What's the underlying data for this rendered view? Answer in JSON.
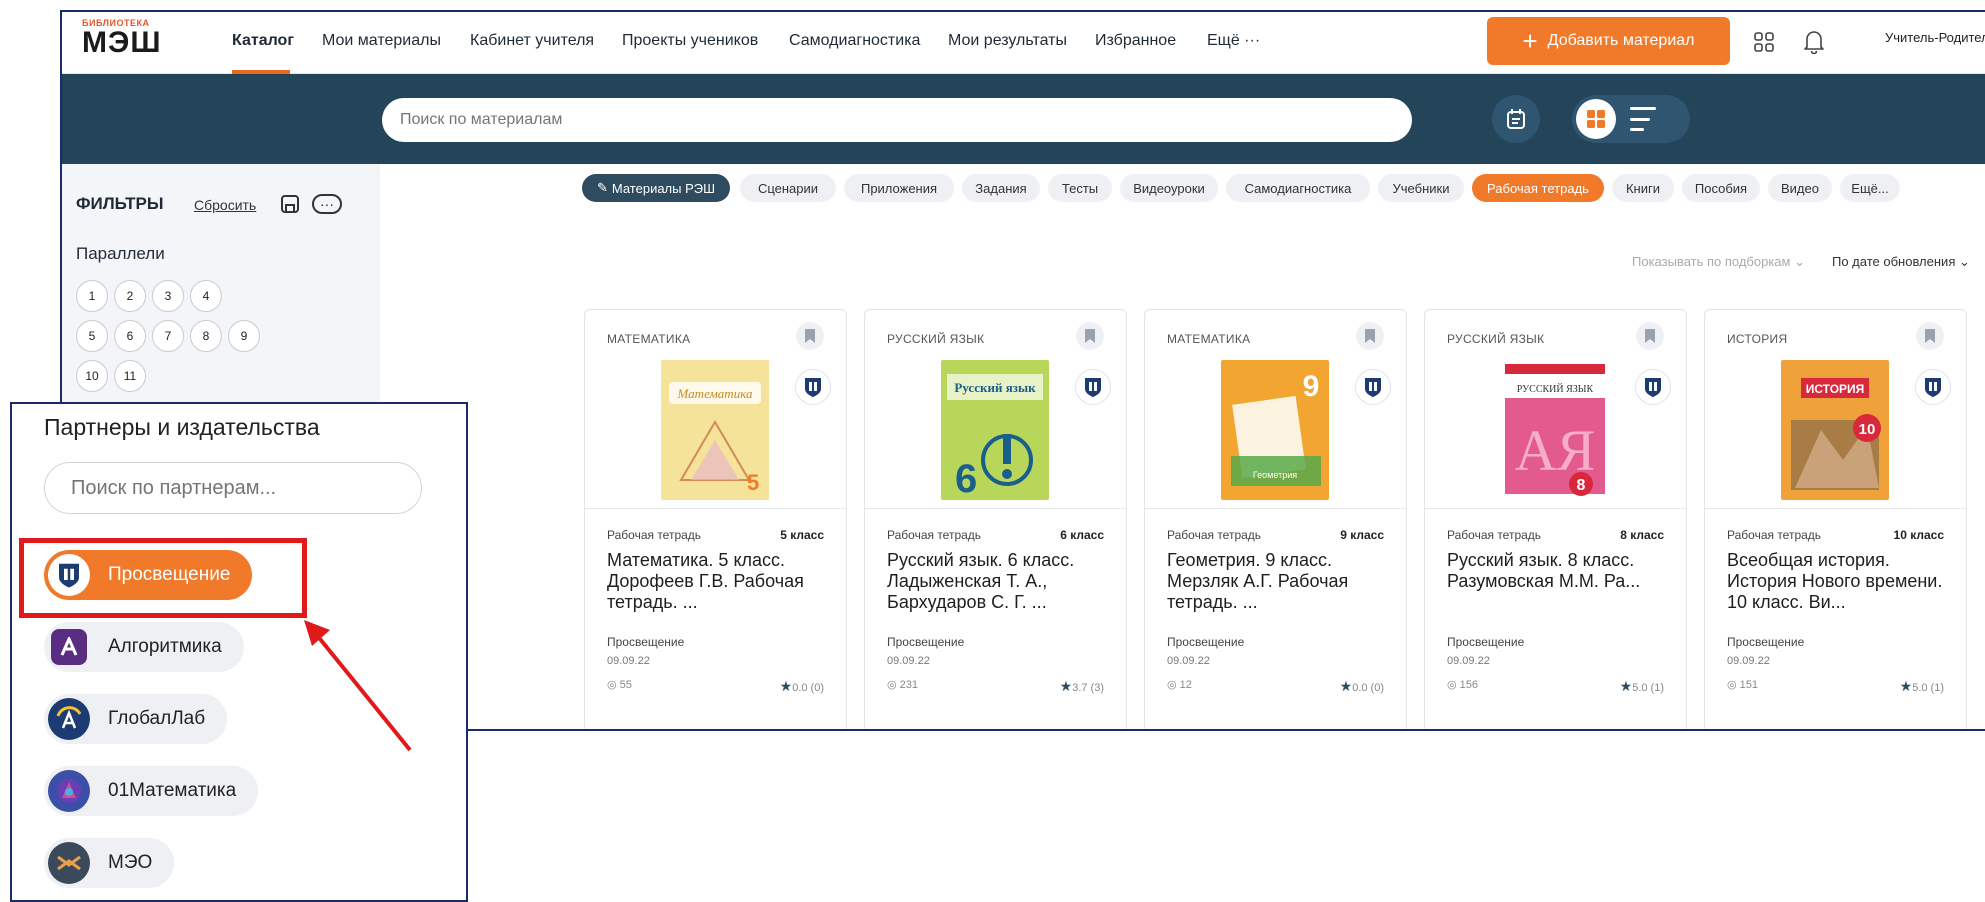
{
  "logo": {
    "small": "БИБЛИОТЕКА",
    "big": "МЭШ"
  },
  "nav": {
    "items": [
      "Каталог",
      "Мои материалы",
      "Кабинет учителя",
      "Проекты учеников",
      "Самодиагностика",
      "Мои результаты",
      "Избранное",
      "Ещё ···"
    ],
    "add_button": "Добавить материал",
    "user": "Учитель-Родител"
  },
  "search": {
    "placeholder": "Поиск по материалам"
  },
  "filters": {
    "title": "ФИЛЬТРЫ",
    "reset": "Сбросить",
    "more": "···",
    "parallels_title": "Параллели",
    "grades": [
      "1",
      "2",
      "3",
      "4",
      "5",
      "6",
      "7",
      "8",
      "9",
      "10",
      "11"
    ]
  },
  "chips": [
    "Материалы РЭШ",
    "Сценарии",
    "Приложения",
    "Задания",
    "Тесты",
    "Видеоуроки",
    "Самодиагностика",
    "Учебники",
    "Рабочая тетрадь",
    "Книги",
    "Пособия",
    "Видео",
    "Ещё..."
  ],
  "sort": {
    "left": "Показывать по подборкам ⌄",
    "right": "По дате обновления ⌄"
  },
  "cards": [
    {
      "subject": "МАТЕМАТИКА",
      "type": "Рабочая тетрадь",
      "grade": "5 класс",
      "title": "Математика. 5 класс. Дорофеев Г.В. Рабочая тетрадь. ...",
      "publisher": "Просвещение",
      "date": "09.09.22",
      "views": "55",
      "rating": "0.0 (0)",
      "cover_text": "Математика",
      "cover_num": "5",
      "cover_color": "#f2d36c"
    },
    {
      "subject": "РУССКИЙ ЯЗЫК",
      "type": "Рабочая тетрадь",
      "grade": "6 класс",
      "title": "Русский язык. 6 класс. Ладыженская Т. А., Бархударов С. Г. ...",
      "publisher": "Просвещение",
      "date": "09.09.22",
      "views": "231",
      "rating": "3.7 (3)",
      "cover_text": "Русский язык",
      "cover_num": "6",
      "cover_color": "#b7d65a"
    },
    {
      "subject": "МАТЕМАТИКА",
      "type": "Рабочая тетрадь",
      "grade": "9 класс",
      "title": "Геометрия. 9 класс. Мерзляк А.Г. Рабочая тетрадь. ...",
      "publisher": "Просвещение",
      "date": "09.09.22",
      "views": "12",
      "rating": "0.0 (0)",
      "cover_text": "Геометрия",
      "cover_num": "9",
      "cover_color": "#f2a531"
    },
    {
      "subject": "РУССКИЙ ЯЗЫК",
      "type": "Рабочая тетрадь",
      "grade": "8 класс",
      "title": "Русский язык. 8 класс. Разумовская М.М. Ра...",
      "publisher": "Просвещение",
      "date": "09.09.22",
      "views": "156",
      "rating": "5.0 (1)",
      "cover_text": "РУССКИЙ ЯЗЫК",
      "cover_num": "8",
      "cover_color": "#e35a8f"
    },
    {
      "subject": "ИСТОРИЯ",
      "type": "Рабочая тетрадь",
      "grade": "10 класс",
      "title": "Всеобщая история. История Нового времени. 10 класс. Ви...",
      "publisher": "Просвещение",
      "date": "09.09.22",
      "views": "151",
      "rating": "5.0 (1)",
      "cover_text": "ИСТОРИЯ",
      "cover_num": "10",
      "cover_color": "#f0a23a"
    }
  ],
  "partners": {
    "title": "Партнеры и издательства",
    "placeholder": "Поиск по партнерам...",
    "items": [
      "Просвещение",
      "Алгоритмика",
      "ГлобалЛаб",
      "01Математика",
      "МЭО"
    ]
  },
  "colors": {
    "accent": "#f07a2a",
    "band": "#234459",
    "highlight": "#e0191b",
    "frame": "#1b2a6b"
  }
}
